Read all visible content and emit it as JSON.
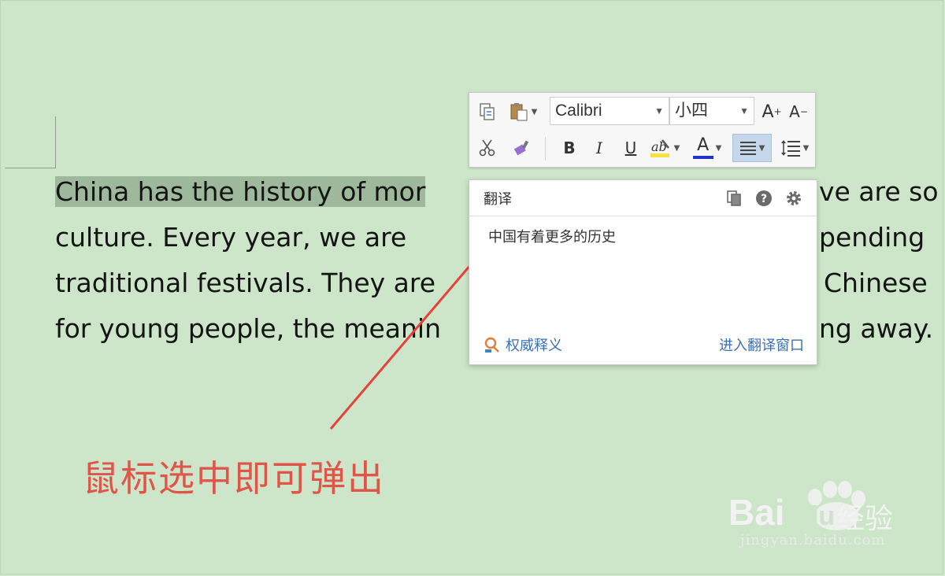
{
  "document": {
    "lines": [
      {
        "selected": "China has the history of mor",
        "rest": "ve are so"
      },
      {
        "left": "culture. Every year, we are",
        "rest": "pending"
      },
      {
        "left": "traditional festivals. They are",
        "rest": "Chinese"
      },
      {
        "left": "for young people, the meanin",
        "rest": "ng away."
      }
    ]
  },
  "mini_toolbar": {
    "font_name": "Calibri",
    "font_size": "小四",
    "bold": "B",
    "italic": "I",
    "underline": "U",
    "font_color_letter": "A",
    "grow_font": "A",
    "shrink_font": "A",
    "grow_mark": "+",
    "shrink_mark": "−",
    "highlight_color": "#f5e23a",
    "font_color": "#2233cc"
  },
  "translate_popup": {
    "title": "翻译",
    "result": "中国有着更多的历史",
    "authority_link": "权威释义",
    "open_window_link": "进入翻译窗口"
  },
  "annotation": {
    "text": "鼠标选中即可弹出",
    "color": "#e0554a"
  },
  "watermark": {
    "brand": "Bai",
    "brand_du": "du",
    "cn": "经验",
    "url": "jingyan.baidu.com"
  }
}
